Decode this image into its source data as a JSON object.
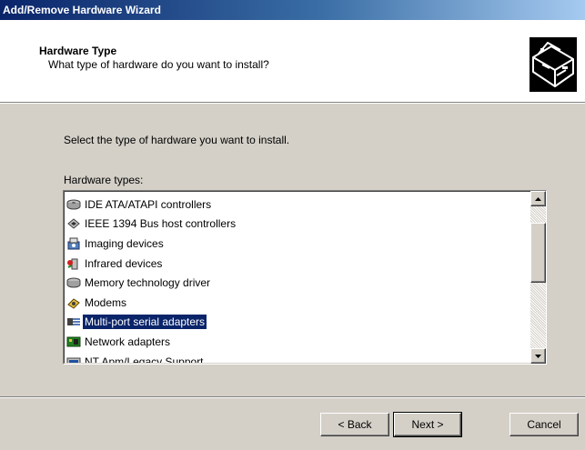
{
  "window": {
    "title": "Add/Remove Hardware Wizard"
  },
  "header": {
    "title": "Hardware Type",
    "subtitle": "What type of hardware do you want to install?",
    "icon": "hardware-wizard-icon"
  },
  "body": {
    "prompt": "Select the type of hardware you want to install.",
    "list_label": "Hardware types:"
  },
  "hardware_types": {
    "items": [
      {
        "label": "IDE ATA/ATAPI controllers",
        "icon": "ide-controller-icon"
      },
      {
        "label": "IEEE 1394 Bus host controllers",
        "icon": "ieee1394-icon"
      },
      {
        "label": "Imaging devices",
        "icon": "imaging-device-icon"
      },
      {
        "label": "Infrared devices",
        "icon": "infrared-device-icon"
      },
      {
        "label": "Memory technology driver",
        "icon": "memory-driver-icon"
      },
      {
        "label": "Modems",
        "icon": "modem-icon"
      },
      {
        "label": "Multi-port serial adapters",
        "icon": "serial-adapter-icon",
        "selected": true
      },
      {
        "label": "Network adapters",
        "icon": "network-adapter-icon"
      },
      {
        "label": "NT Apm/Legacy Support",
        "icon": "legacy-support-icon"
      }
    ],
    "selected": "Multi-port serial adapters"
  },
  "buttons": {
    "back": "< Back",
    "next": "Next >",
    "cancel": "Cancel"
  },
  "colors": {
    "titlebar": "#0a246a",
    "selection": "#0a246a",
    "face": "#d4d0c8"
  }
}
